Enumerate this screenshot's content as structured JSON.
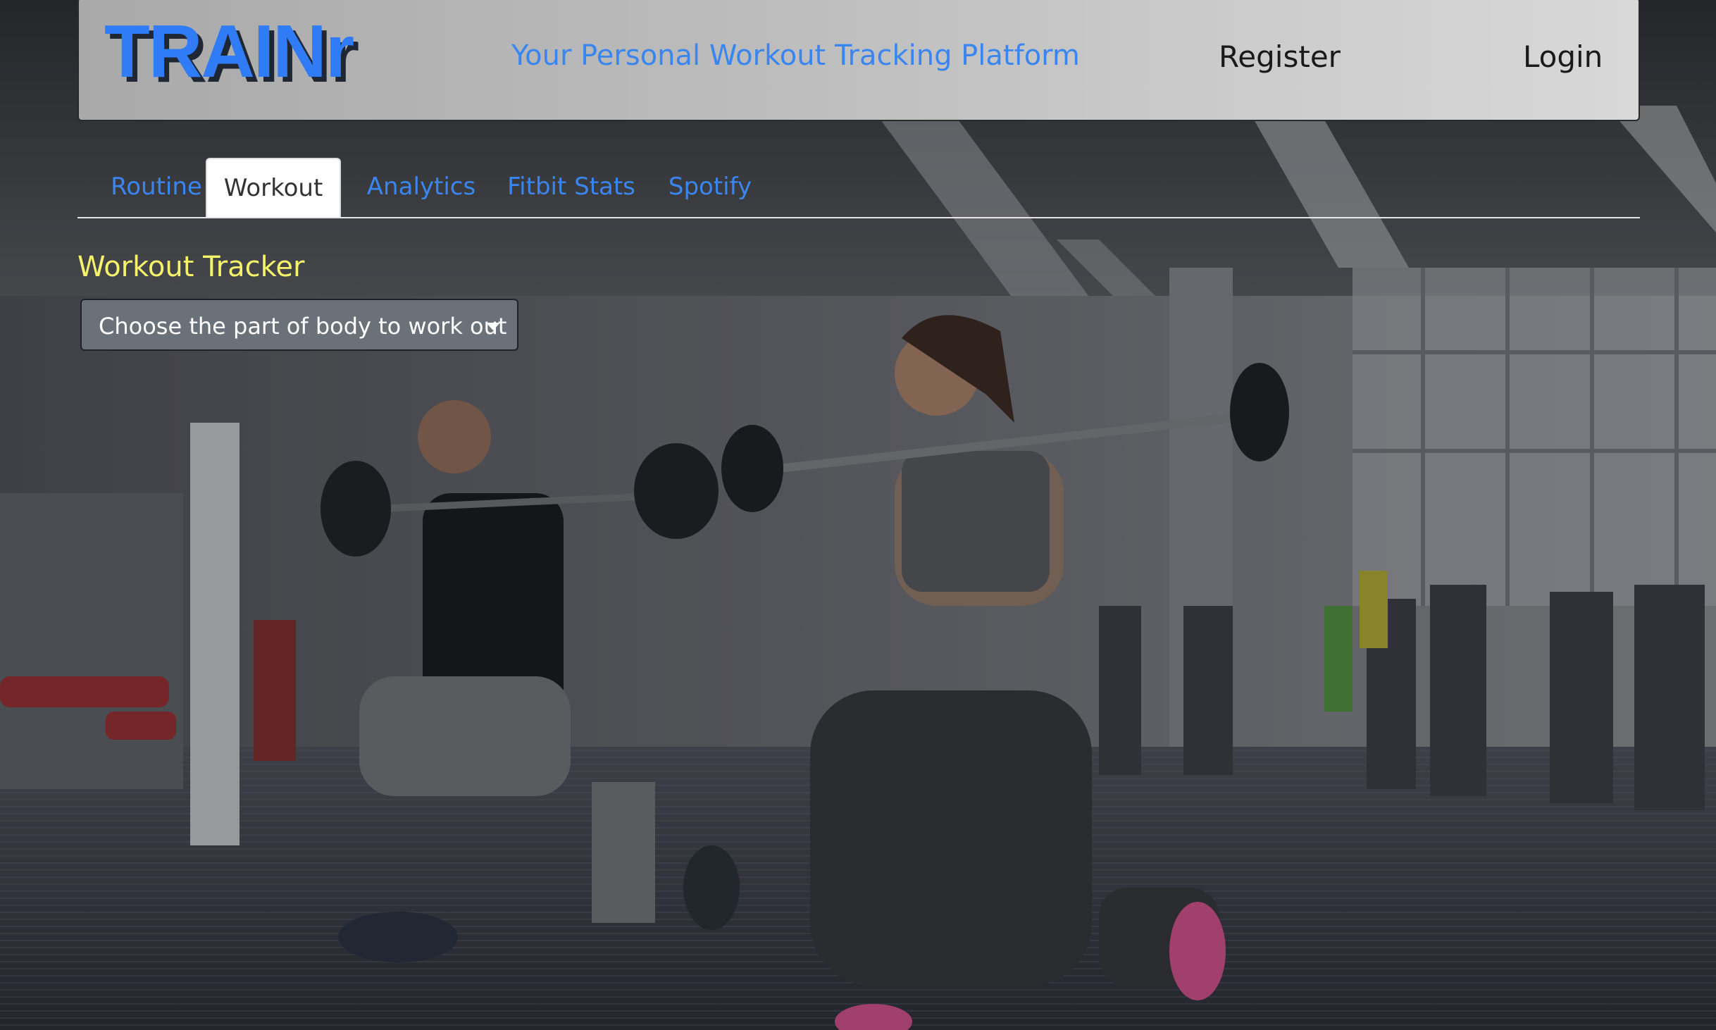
{
  "header": {
    "brand": "TRAINr",
    "tagline": "Your Personal Workout Tracking Platform",
    "nav": {
      "register": "Register",
      "login": "Login"
    }
  },
  "tabs": [
    {
      "label": "Routine",
      "active": false
    },
    {
      "label": "Workout",
      "active": true
    },
    {
      "label": "Analytics",
      "active": false
    },
    {
      "label": "Fitbit Stats",
      "active": false
    },
    {
      "label": "Spotify",
      "active": false
    }
  ],
  "main": {
    "title": "Workout Tracker",
    "body_part_dropdown": {
      "selected": "Choose the part of body to work out",
      "icon": "chevron-down-icon"
    }
  },
  "background": {
    "description_icon": "gym-photo"
  },
  "colors": {
    "brand": "#2f7cf6",
    "link": "#3a86f0",
    "title": "#f5f36a",
    "dropdown_bg": "#6b7178"
  }
}
